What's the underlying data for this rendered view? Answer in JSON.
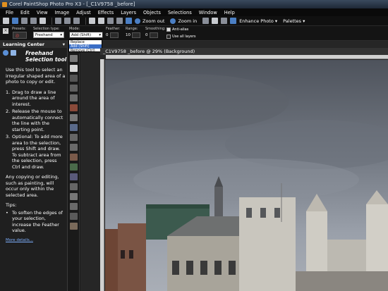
{
  "titlebar": {
    "title": "Corel PaintShop Photo Pro X3 - [_C1V9758 _before]"
  },
  "menu": [
    "File",
    "Edit",
    "View",
    "Image",
    "Adjust",
    "Effects",
    "Layers",
    "Objects",
    "Selections",
    "Window",
    "Help"
  ],
  "toolbar": {
    "zoom_out": "Zoom out",
    "zoom_in": "Zoom in",
    "enhance_photo": "Enhance Photo",
    "palettes": "Palettes"
  },
  "options": {
    "presets_label": "Presets:",
    "selection_type_label": "Selection type:",
    "selection_type_value": "Freehand",
    "mode_label": "Mode:",
    "mode_value": "Add (Shift)",
    "feather_label": "Feather:",
    "feather_value": "0",
    "range_label": "Range:",
    "range_value": "10",
    "smoothing_label": "Smoothing:",
    "smoothing_value": "0",
    "antialias_label": "Anti-alias",
    "use_all_layers_label": "Use all layers"
  },
  "mode_dropdown": [
    "Replace",
    "Add (Shift)",
    "Remove (Ctrl)"
  ],
  "learning_center": {
    "header": "Learning Center",
    "tool_title_line1": "Freehand",
    "tool_title_line2": "Selection tool",
    "intro": "Use this tool to select an irregular shaped area of a photo to copy or edit.",
    "steps": [
      {
        "n": "1.",
        "text": "Drag to draw a line around the area of interest."
      },
      {
        "n": "2.",
        "text": "Release the mouse to automatically connect the line with the starting point."
      },
      {
        "n": "3.",
        "text": "Optional: To add more area to the selection, press Shift and draw. To subtract area from the selection, press Ctrl and draw."
      }
    ],
    "note": "Any copying or editing, such as painting, will occur only within the selected area.",
    "tips_label": "Tips:",
    "tip": "To soften the edges of your selection, increase the Feather value.",
    "more": "More details..."
  },
  "image_window": {
    "title": "_C1V9758 _before @ 29% (Background)"
  },
  "colors": {
    "menubar": "#0a0a0a",
    "panel": "#1f1f1f",
    "accent": "#3a6ec6"
  }
}
